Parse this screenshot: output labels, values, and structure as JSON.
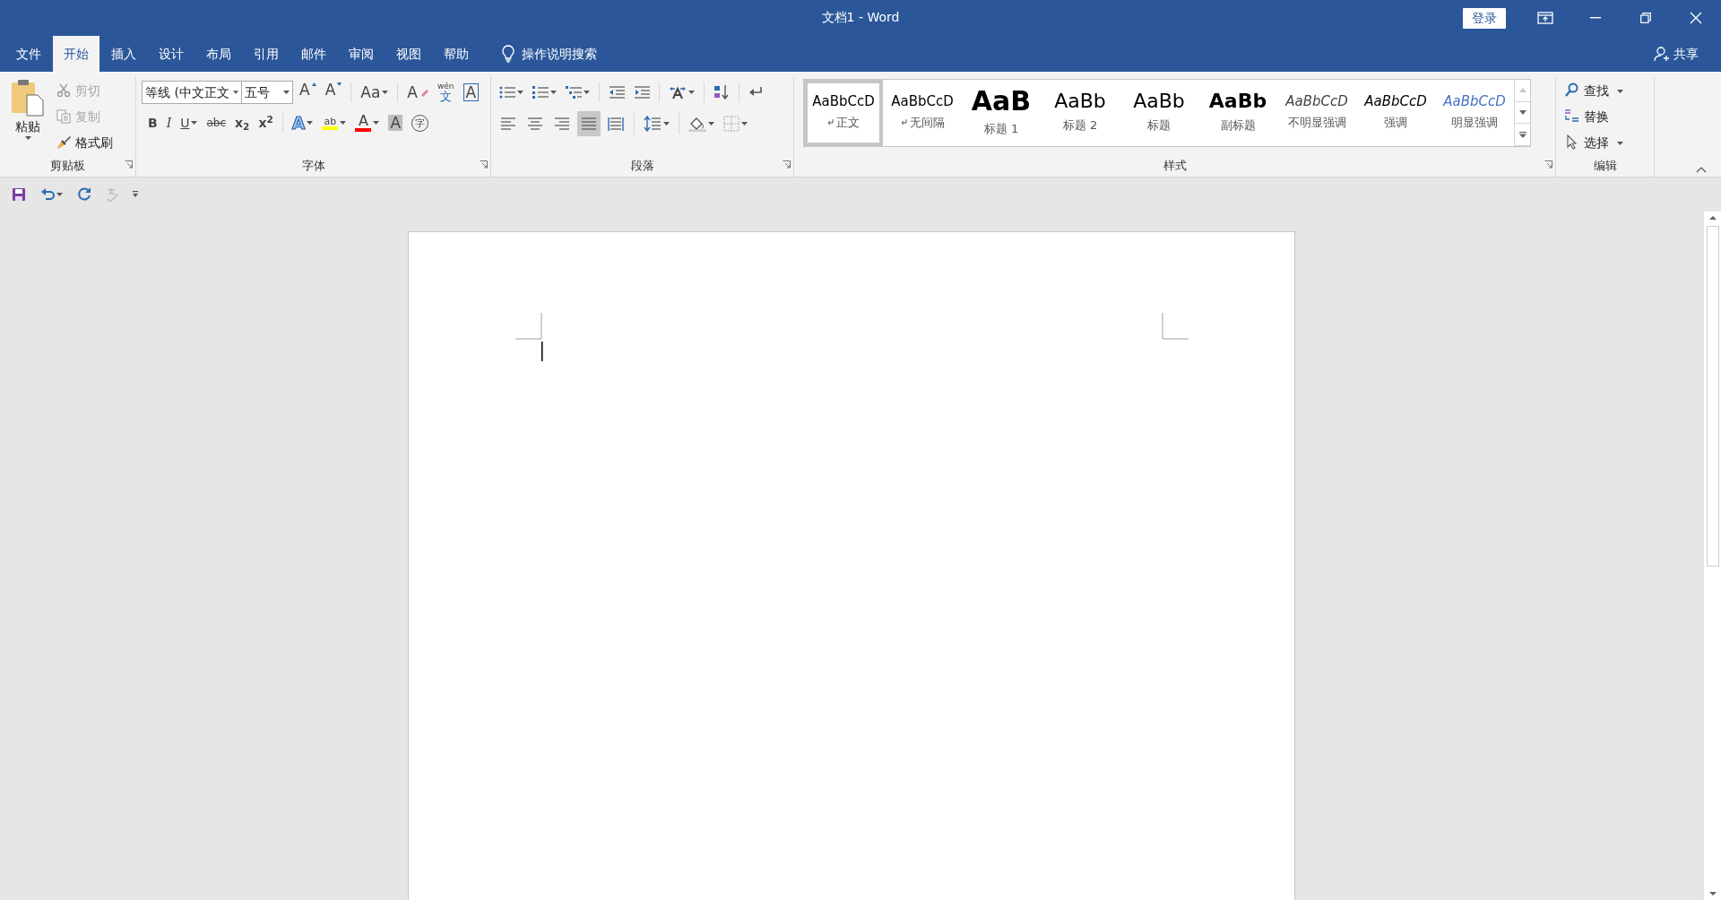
{
  "window": {
    "title": "文档1  -  Word",
    "sign_in": "登录"
  },
  "tabs": [
    {
      "label": "文件",
      "selected": false
    },
    {
      "label": "开始",
      "selected": true
    },
    {
      "label": "插入",
      "selected": false
    },
    {
      "label": "设计",
      "selected": false
    },
    {
      "label": "布局",
      "selected": false
    },
    {
      "label": "引用",
      "selected": false
    },
    {
      "label": "邮件",
      "selected": false
    },
    {
      "label": "审阅",
      "selected": false
    },
    {
      "label": "视图",
      "selected": false
    },
    {
      "label": "帮助",
      "selected": false
    }
  ],
  "tell_me": "操作说明搜索",
  "share": "共享",
  "quick_access": [
    {
      "kind": "save",
      "disabled": false
    },
    {
      "kind": "undo",
      "disabled": false
    },
    {
      "kind": "redo",
      "disabled": false
    },
    {
      "kind": "spelling",
      "disabled": true
    }
  ],
  "clipboard": {
    "label": "剪贴板",
    "paste": "粘贴",
    "items": [
      {
        "kind": "cut",
        "label": "剪切",
        "disabled": true
      },
      {
        "kind": "copy",
        "label": "复制",
        "disabled": true
      },
      {
        "kind": "brush",
        "label": "格式刷",
        "disabled": false
      }
    ]
  },
  "font": {
    "label": "字体",
    "font_name": "等线 (中文正文",
    "font_size": "五号",
    "row1": [
      {
        "kind": "grow",
        "glyph": "A"
      },
      {
        "kind": "shrink",
        "glyph": "A"
      },
      {
        "kind": "case",
        "glyph": "Aa"
      },
      {
        "kind": "clear",
        "glyph": "A"
      },
      {
        "kind": "phonetic",
        "glyph": "文",
        "ruby": "wén"
      },
      {
        "kind": "border",
        "glyph": "A"
      }
    ],
    "row2": [
      {
        "kind": "bold",
        "glyph": "B"
      },
      {
        "kind": "italic",
        "glyph": "I"
      },
      {
        "kind": "underline",
        "glyph": "U"
      },
      {
        "kind": "strike",
        "glyph": "abc"
      },
      {
        "kind": "script",
        "glyph": "x$_{2}$"
      },
      {
        "kind": "script",
        "glyph": "x$^{2}$"
      },
      {
        "kind": "effects",
        "glyph": "A"
      },
      {
        "kind": "highlight",
        "glyph": "ab",
        "color": "#ffff00"
      },
      {
        "kind": "color",
        "glyph": "A",
        "color": "#ff0000"
      },
      {
        "kind": "shading",
        "glyph": "A"
      },
      {
        "kind": "enclosed",
        "glyph": "字"
      }
    ]
  },
  "paragraph": {
    "label": "段落",
    "alignment": [
      {
        "kind": "left",
        "selected": false
      },
      {
        "kind": "center",
        "selected": false
      },
      {
        "kind": "right",
        "selected": false
      },
      {
        "kind": "justify",
        "selected": true
      },
      {
        "kind": "distributed",
        "selected": false
      }
    ]
  },
  "styles": {
    "label": "样式",
    "items": [
      {
        "kind": "normal",
        "preview": "AaBbCcD",
        "name": "正文",
        "paragraph_mark": true,
        "selected": true
      },
      {
        "kind": "normal",
        "preview": "AaBbCcD",
        "name": "无间隔",
        "paragraph_mark": true,
        "selected": false
      },
      {
        "kind": "heading1",
        "preview": "AaB",
        "name": "标题 1",
        "paragraph_mark": false,
        "selected": false
      },
      {
        "kind": "heading2",
        "preview": "AaBb",
        "name": "标题 2",
        "paragraph_mark": false,
        "selected": false
      },
      {
        "kind": "heading2",
        "preview": "AaBb",
        "name": "标题",
        "paragraph_mark": false,
        "selected": false
      },
      {
        "kind": "subtitle",
        "preview": "AaBb",
        "name": "副标题",
        "paragraph_mark": false,
        "selected": false
      },
      {
        "kind": "subtle",
        "preview": "AaBbCcD",
        "name": "不明显强调",
        "paragraph_mark": false,
        "selected": false
      },
      {
        "kind": "emphasis",
        "preview": "AaBbCcD",
        "name": "强调",
        "paragraph_mark": false,
        "selected": false
      },
      {
        "kind": "intense",
        "preview": "AaBbCcD",
        "name": "明显强调",
        "paragraph_mark": false,
        "selected": false
      }
    ]
  },
  "editing": {
    "label": "编辑",
    "items": [
      {
        "kind": "find",
        "label": "查找",
        "dropdown": true
      },
      {
        "kind": "replace",
        "label": "替换",
        "dropdown": false
      },
      {
        "kind": "select",
        "label": "选择",
        "dropdown": true
      }
    ]
  }
}
